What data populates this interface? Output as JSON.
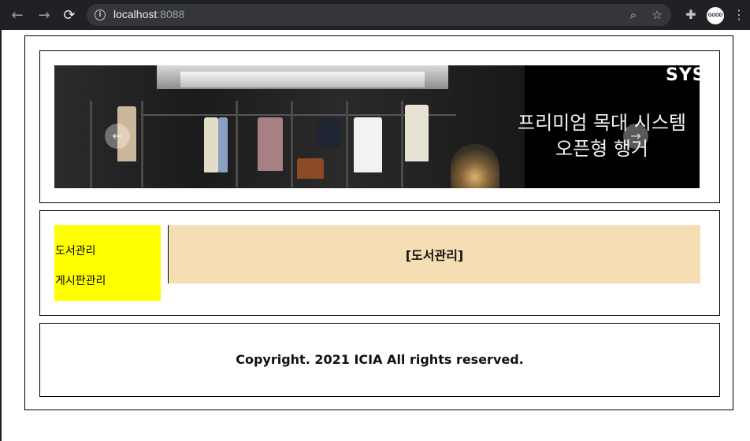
{
  "browser": {
    "url_host": "localhost",
    "url_port": ":8088",
    "avatar_text": "GOOD"
  },
  "banner": {
    "brand": "SYS",
    "headline_line1": "프리미엄 목대 시스템",
    "headline_line2": "오픈형 행거"
  },
  "aside": {
    "items": [
      {
        "label": "도서관리"
      },
      {
        "label": "게시판관리"
      }
    ]
  },
  "content": {
    "title": "[도서관리]"
  },
  "footer": {
    "copyright": "Copyright. 2021 ICIA All rights reserved."
  },
  "colors": {
    "aside_bg": "#ffff00",
    "content_bg": "#f5deb3",
    "chrome_bg": "#202124"
  }
}
